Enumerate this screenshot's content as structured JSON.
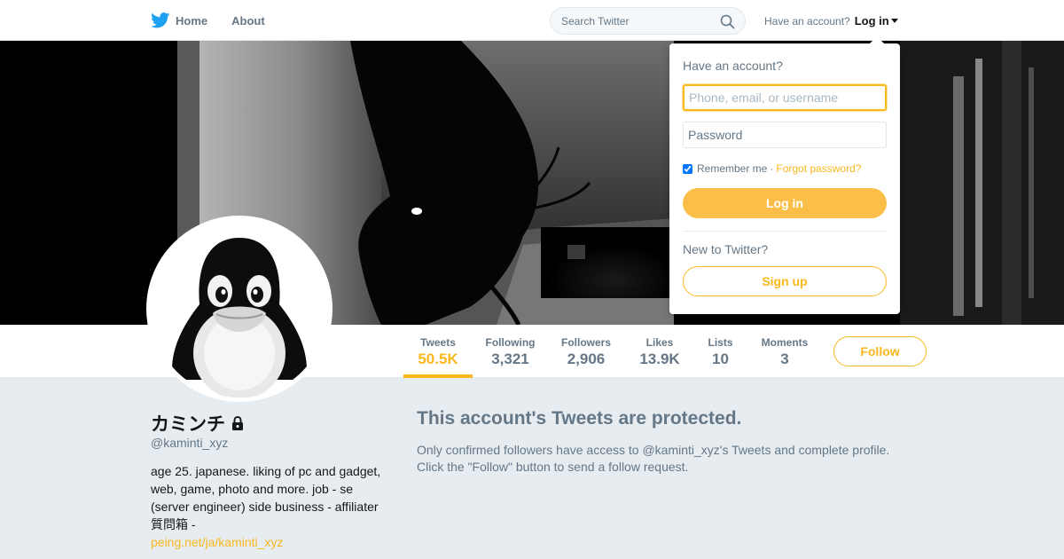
{
  "nav": {
    "home_label": "Home",
    "about_label": "About",
    "search_placeholder": "Search Twitter",
    "have_account": "Have an account?",
    "login_label": "Log in"
  },
  "profile_nav": {
    "stats": [
      {
        "label": "Tweets",
        "value": "50.5K",
        "active": true
      },
      {
        "label": "Following",
        "value": "3,321"
      },
      {
        "label": "Followers",
        "value": "2,906"
      },
      {
        "label": "Likes",
        "value": "13.9K"
      },
      {
        "label": "Lists",
        "value": "10"
      },
      {
        "label": "Moments",
        "value": "3"
      }
    ],
    "follow_label": "Follow"
  },
  "profile": {
    "name": "カミンチ",
    "handle": "@kaminti_xyz",
    "bio": "age 25. japanese. liking of pc and gadget, web, game, photo and more. job - se (server engineer) side business - affiliater 質問箱 -",
    "bio_link": "peing.net/ja/kaminti_xyz"
  },
  "protected": {
    "title": "This account's Tweets are protected.",
    "body": "Only confirmed followers have access to @kaminti_xyz's Tweets and complete profile. Click the \"Follow\" button to send a follow request."
  },
  "login_dropdown": {
    "heading": "Have an account?",
    "username_placeholder": "Phone, email, or username",
    "password_placeholder": "Password",
    "remember_label": "Remember me",
    "separator": "·",
    "forgot_label": "Forgot password?",
    "login_button": "Log in",
    "new_heading": "New to Twitter?",
    "signup_button": "Sign up"
  },
  "colors": {
    "accent": "#fab81e",
    "text_secondary": "#657786",
    "twitter_blue": "#1da1f2",
    "background": "#e6ecf0"
  }
}
